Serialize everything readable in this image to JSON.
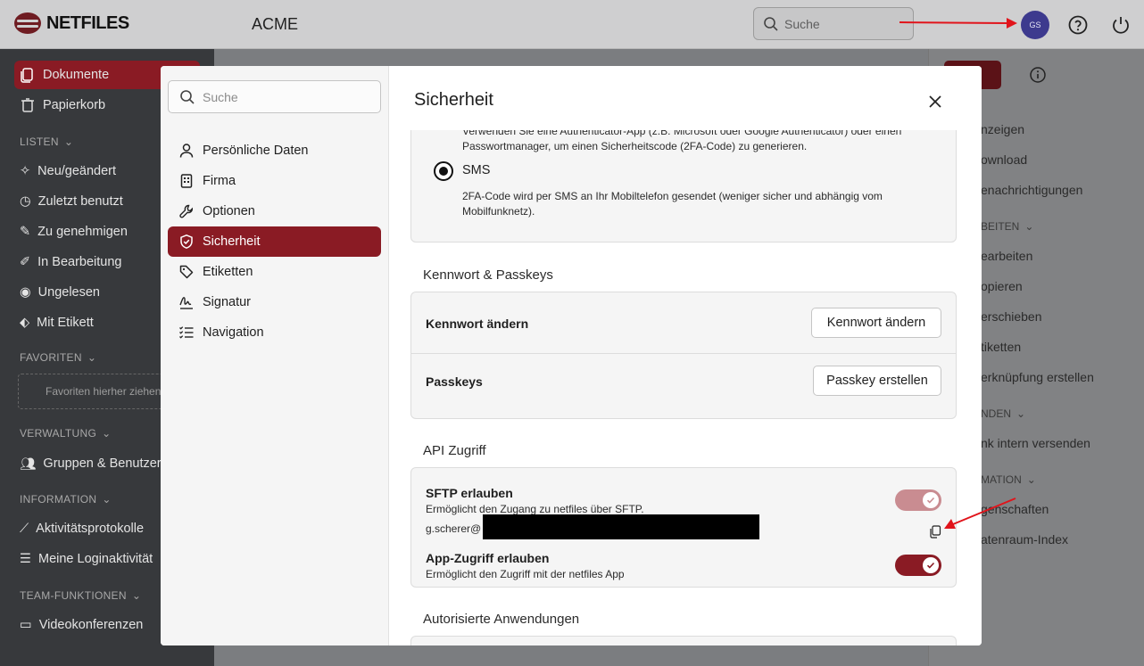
{
  "app": {
    "logo_text": "NETFILES",
    "workspace": "ACME",
    "search_placeholder": "Suche",
    "avatar_initials": "GS"
  },
  "sidebar": {
    "items": [
      {
        "label": "Dokumente",
        "icon": "document-icon"
      },
      {
        "label": "Papierkorb",
        "icon": "trash-icon"
      }
    ],
    "lists_header": "LISTEN",
    "lists": [
      {
        "label": "Neu/geändert",
        "icon": "sparkle-icon"
      },
      {
        "label": "Zuletzt benutzt",
        "icon": "clock-icon"
      },
      {
        "label": "Zu genehmigen",
        "icon": "pencil-icon"
      },
      {
        "label": "In Bearbeitung",
        "icon": "edit-user-icon"
      },
      {
        "label": "Ungelesen",
        "icon": "eye-icon"
      },
      {
        "label": "Mit Etikett",
        "icon": "tag-icon"
      }
    ],
    "favorites_header": "FAVORITEN",
    "favorites_placeholder": "Favoriten hierher ziehen",
    "admin_header": "VERWALTUNG",
    "admin": [
      {
        "label": "Gruppen & Benutzer",
        "icon": "users-icon"
      }
    ],
    "info_header": "INFORMATION",
    "info": [
      {
        "label": "Aktivitätsprotokolle",
        "icon": "chart-icon"
      },
      {
        "label": "Meine Loginaktivität",
        "icon": "list-icon"
      }
    ],
    "team_header": "TEAM-FUNKTIONEN",
    "team": [
      {
        "label": "Videokonferenzen",
        "icon": "video-icon"
      }
    ]
  },
  "right_panel": {
    "items": [
      "nzeigen",
      "ownload",
      "enachrichtigungen"
    ],
    "head1": "BEITEN",
    "items2": [
      "earbeiten",
      "opieren",
      "erschieben",
      "tiketten",
      "erknüpfung erstellen"
    ],
    "head2": "NDEN",
    "items3": [
      "nk intern versenden"
    ],
    "head3": "MATION",
    "items4": [
      "genschaften",
      "atenraum-Index"
    ]
  },
  "modal": {
    "search_placeholder": "Suche",
    "nav": [
      {
        "label": "Persönliche Daten",
        "icon": "person-icon"
      },
      {
        "label": "Firma",
        "icon": "building-icon"
      },
      {
        "label": "Optionen",
        "icon": "wrench-icon"
      },
      {
        "label": "Sicherheit",
        "icon": "shield-icon"
      },
      {
        "label": "Etiketten",
        "icon": "tag-icon"
      },
      {
        "label": "Signatur",
        "icon": "signature-icon"
      },
      {
        "label": "Navigation",
        "icon": "checklist-icon"
      }
    ],
    "title": "Sicherheit",
    "twofa": {
      "app_desc": "Verwenden Sie eine Authenticator-App (z.B. Microsoft oder Google Authenticator) oder einen Passwortmanager, um einen Sicherheitscode (2FA-Code) zu generieren.",
      "sms_label": "SMS",
      "sms_desc": "2FA-Code wird per SMS an Ihr Mobiltelefon gesendet (weniger sicher und abhängig vom Mobilfunknetz)."
    },
    "password": {
      "section": "Kennwort & Passkeys",
      "change_label": "Kennwort ändern",
      "change_button": "Kennwort ändern",
      "passkeys_label": "Passkeys",
      "passkey_button": "Passkey erstellen"
    },
    "api": {
      "section": "API Zugriff",
      "sftp_label": "SFTP erlauben",
      "sftp_desc": "Ermöglicht den Zugang zu netfiles über SFTP.",
      "sftp_user": "g.scherer@",
      "app_label": "App-Zugriff erlauben",
      "app_desc": "Ermöglicht den Zugriff mit der netfiles App"
    },
    "authorized_section": "Autorisierte Anwendungen"
  },
  "colors": {
    "accent": "#8a1b24",
    "annotation_red": "#e1141b",
    "redaction": "#000000"
  }
}
